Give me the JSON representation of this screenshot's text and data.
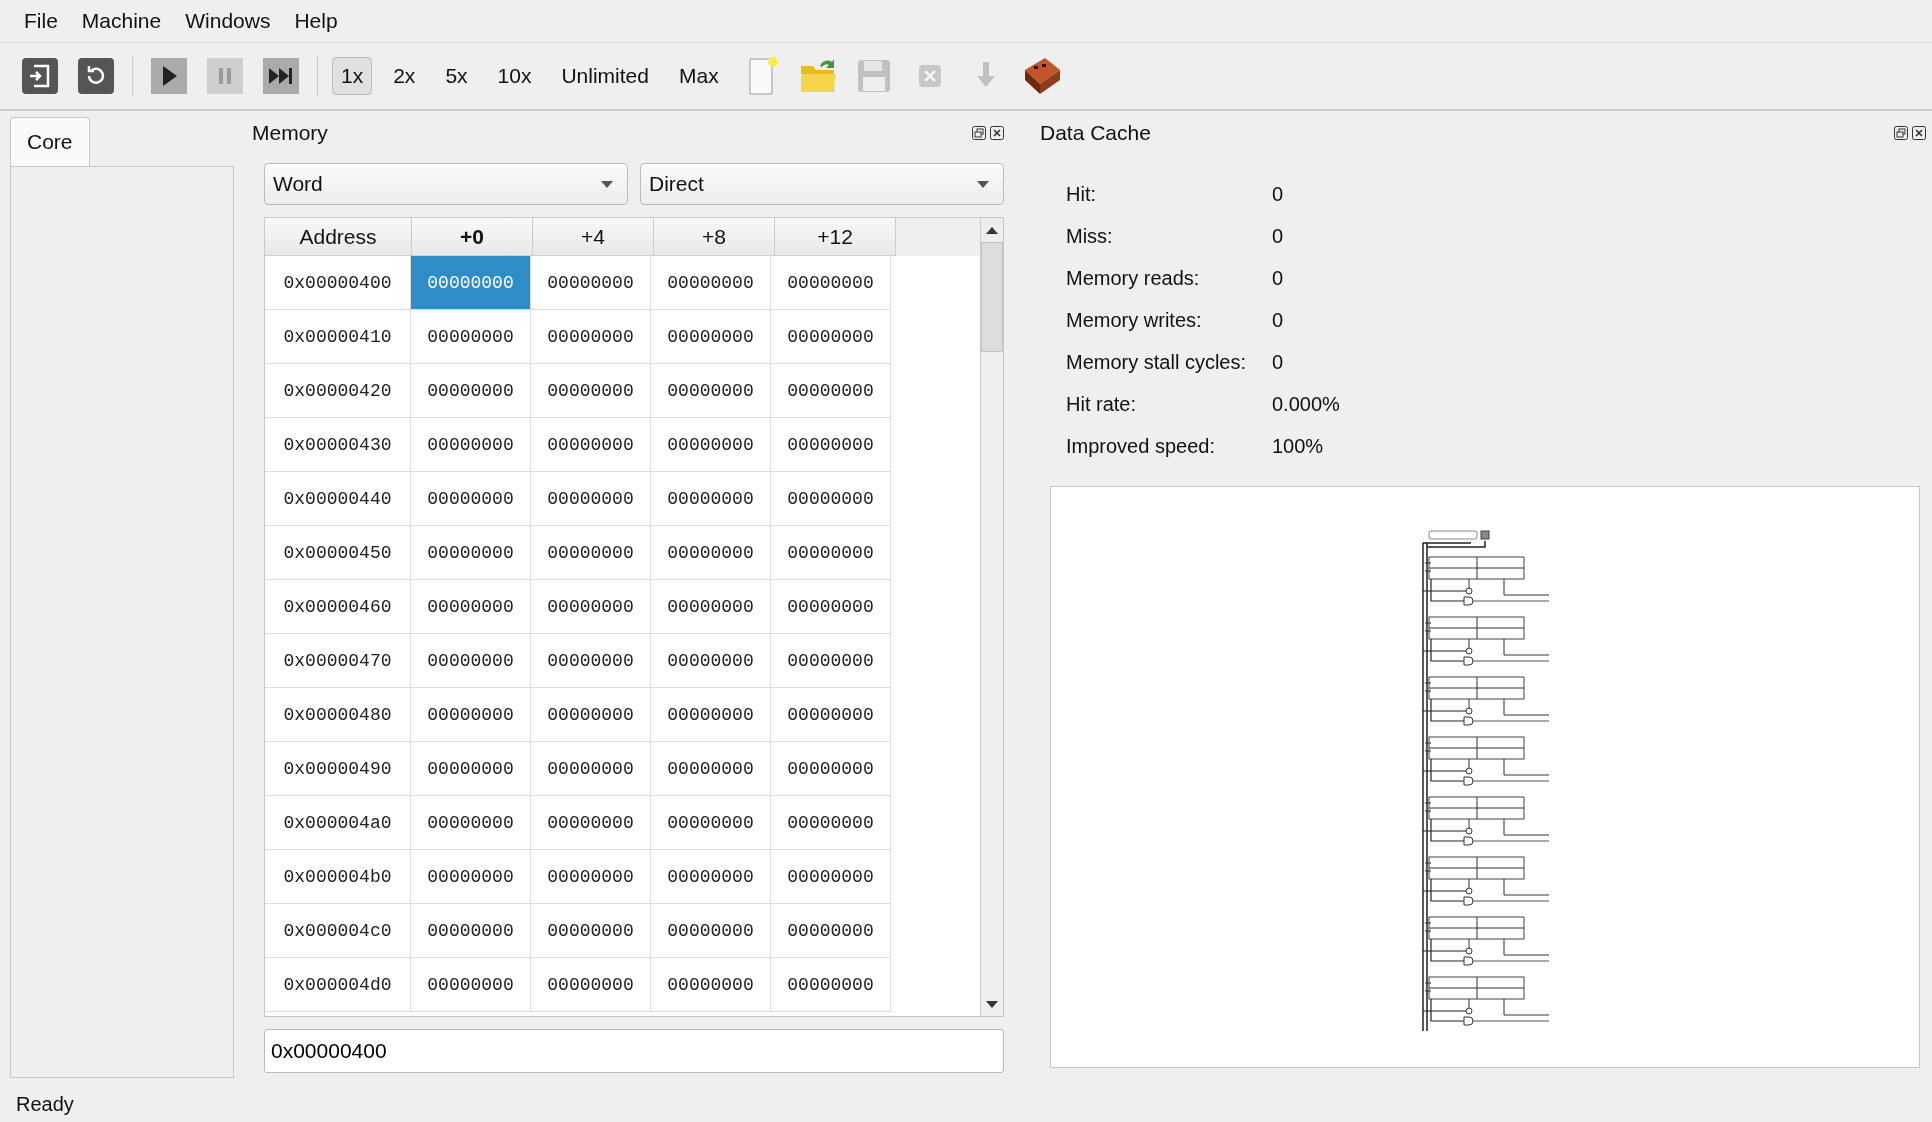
{
  "menu": [
    "File",
    "Machine",
    "Windows",
    "Help"
  ],
  "toolbar": [
    {
      "kind": "reset",
      "disabled": false
    },
    {
      "kind": "reload",
      "disabled": false
    },
    {
      "kind": "sep"
    },
    {
      "kind": "run",
      "disabled": false
    },
    {
      "kind": "pause",
      "disabled": true
    },
    {
      "kind": "step",
      "disabled": false
    },
    {
      "kind": "sep"
    },
    {
      "kind": "speed",
      "label": "1x",
      "selected": true
    },
    {
      "kind": "speed",
      "label": "2x",
      "selected": false
    },
    {
      "kind": "speed",
      "label": "5x",
      "selected": false
    },
    {
      "kind": "speed",
      "label": "10x",
      "selected": false
    },
    {
      "kind": "speed",
      "label": "Unlimited",
      "selected": false
    },
    {
      "kind": "speed",
      "label": "Max",
      "selected": false
    },
    {
      "kind": "new",
      "disabled": false
    },
    {
      "kind": "open",
      "disabled": false
    },
    {
      "kind": "save",
      "disabled": true
    },
    {
      "kind": "close",
      "disabled": true
    },
    {
      "kind": "download",
      "disabled": true
    },
    {
      "kind": "brick",
      "disabled": false
    }
  ],
  "left_tabs": [
    {
      "label": "Core",
      "selected": true
    }
  ],
  "memory": {
    "title": "Memory",
    "unit": "Word",
    "mode": "Direct",
    "columns": [
      "Address",
      "+0",
      "+4",
      "+8",
      "+12"
    ],
    "rows": [
      {
        "cells": [
          {
            "value": "0x00000400",
            "selected": false
          },
          {
            "value": "00000000",
            "selected": true
          },
          {
            "value": "00000000",
            "selected": false
          },
          {
            "value": "00000000",
            "selected": false
          },
          {
            "value": "00000000",
            "selected": false
          }
        ]
      },
      {
        "cells": [
          {
            "value": "0x00000410",
            "selected": false
          },
          {
            "value": "00000000",
            "selected": false
          },
          {
            "value": "00000000",
            "selected": false
          },
          {
            "value": "00000000",
            "selected": false
          },
          {
            "value": "00000000",
            "selected": false
          }
        ]
      },
      {
        "cells": [
          {
            "value": "0x00000420",
            "selected": false
          },
          {
            "value": "00000000",
            "selected": false
          },
          {
            "value": "00000000",
            "selected": false
          },
          {
            "value": "00000000",
            "selected": false
          },
          {
            "value": "00000000",
            "selected": false
          }
        ]
      },
      {
        "cells": [
          {
            "value": "0x00000430",
            "selected": false
          },
          {
            "value": "00000000",
            "selected": false
          },
          {
            "value": "00000000",
            "selected": false
          },
          {
            "value": "00000000",
            "selected": false
          },
          {
            "value": "00000000",
            "selected": false
          }
        ]
      },
      {
        "cells": [
          {
            "value": "0x00000440",
            "selected": false
          },
          {
            "value": "00000000",
            "selected": false
          },
          {
            "value": "00000000",
            "selected": false
          },
          {
            "value": "00000000",
            "selected": false
          },
          {
            "value": "00000000",
            "selected": false
          }
        ]
      },
      {
        "cells": [
          {
            "value": "0x00000450",
            "selected": false
          },
          {
            "value": "00000000",
            "selected": false
          },
          {
            "value": "00000000",
            "selected": false
          },
          {
            "value": "00000000",
            "selected": false
          },
          {
            "value": "00000000",
            "selected": false
          }
        ]
      },
      {
        "cells": [
          {
            "value": "0x00000460",
            "selected": false
          },
          {
            "value": "00000000",
            "selected": false
          },
          {
            "value": "00000000",
            "selected": false
          },
          {
            "value": "00000000",
            "selected": false
          },
          {
            "value": "00000000",
            "selected": false
          }
        ]
      },
      {
        "cells": [
          {
            "value": "0x00000470",
            "selected": false
          },
          {
            "value": "00000000",
            "selected": false
          },
          {
            "value": "00000000",
            "selected": false
          },
          {
            "value": "00000000",
            "selected": false
          },
          {
            "value": "00000000",
            "selected": false
          }
        ]
      },
      {
        "cells": [
          {
            "value": "0x00000480",
            "selected": false
          },
          {
            "value": "00000000",
            "selected": false
          },
          {
            "value": "00000000",
            "selected": false
          },
          {
            "value": "00000000",
            "selected": false
          },
          {
            "value": "00000000",
            "selected": false
          }
        ]
      },
      {
        "cells": [
          {
            "value": "0x00000490",
            "selected": false
          },
          {
            "value": "00000000",
            "selected": false
          },
          {
            "value": "00000000",
            "selected": false
          },
          {
            "value": "00000000",
            "selected": false
          },
          {
            "value": "00000000",
            "selected": false
          }
        ]
      },
      {
        "cells": [
          {
            "value": "0x000004a0",
            "selected": false
          },
          {
            "value": "00000000",
            "selected": false
          },
          {
            "value": "00000000",
            "selected": false
          },
          {
            "value": "00000000",
            "selected": false
          },
          {
            "value": "00000000",
            "selected": false
          }
        ]
      },
      {
        "cells": [
          {
            "value": "0x000004b0",
            "selected": false
          },
          {
            "value": "00000000",
            "selected": false
          },
          {
            "value": "00000000",
            "selected": false
          },
          {
            "value": "00000000",
            "selected": false
          },
          {
            "value": "00000000",
            "selected": false
          }
        ]
      },
      {
        "cells": [
          {
            "value": "0x000004c0",
            "selected": false
          },
          {
            "value": "00000000",
            "selected": false
          },
          {
            "value": "00000000",
            "selected": false
          },
          {
            "value": "00000000",
            "selected": false
          },
          {
            "value": "00000000",
            "selected": false
          }
        ]
      },
      {
        "cells": [
          {
            "value": "0x000004d0",
            "selected": false
          },
          {
            "value": "00000000",
            "selected": false
          },
          {
            "value": "00000000",
            "selected": false
          },
          {
            "value": "00000000",
            "selected": false
          },
          {
            "value": "00000000",
            "selected": false
          }
        ]
      }
    ],
    "address_field": "0x00000400"
  },
  "data_cache": {
    "title": "Data Cache",
    "stats": [
      {
        "label": "Hit:",
        "value": "0"
      },
      {
        "label": "Miss:",
        "value": "0"
      },
      {
        "label": "Memory reads:",
        "value": "0"
      },
      {
        "label": "Memory writes:",
        "value": "0"
      },
      {
        "label": "Memory stall cycles:",
        "value": "0"
      },
      {
        "label": "Hit rate:",
        "value": "0.000%"
      },
      {
        "label": "Improved speed:",
        "value": "100%"
      }
    ]
  },
  "status_bar": "Ready"
}
